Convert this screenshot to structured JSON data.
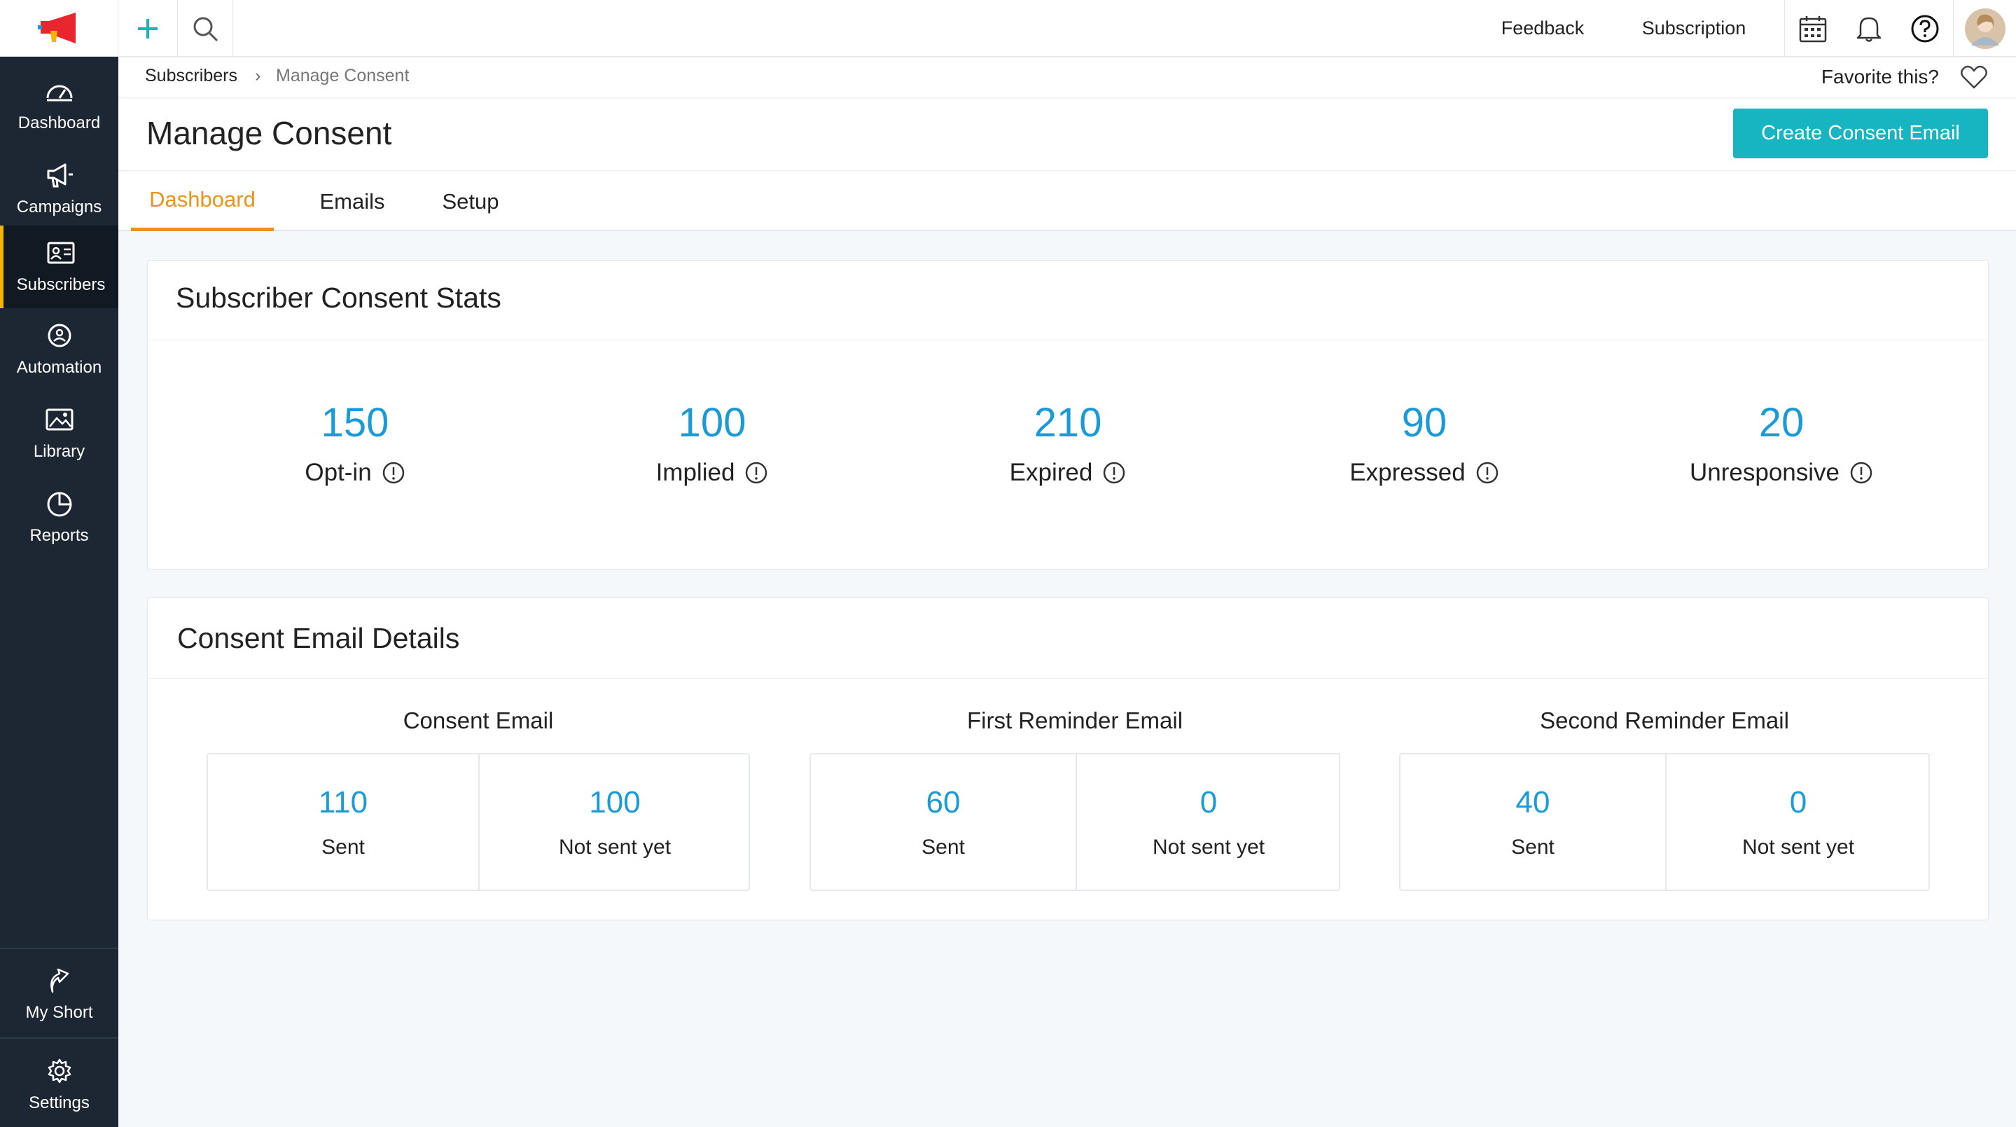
{
  "sidebar": {
    "items": [
      {
        "label": "Dashboard",
        "icon": "gauge-icon"
      },
      {
        "label": "Campaigns",
        "icon": "megaphone-icon"
      },
      {
        "label": "Subscribers",
        "icon": "contact-card-icon",
        "active": true
      },
      {
        "label": "Automation",
        "icon": "automation-icon"
      },
      {
        "label": "Library",
        "icon": "image-icon"
      },
      {
        "label": "Reports",
        "icon": "pie-chart-icon"
      }
    ],
    "bottom_items": [
      {
        "label": "My Short",
        "icon": "shortcut-icon"
      },
      {
        "label": "Settings",
        "icon": "gear-icon"
      }
    ]
  },
  "topbar": {
    "feedback": "Feedback",
    "subscription": "Subscription"
  },
  "breadcrumb": {
    "parent": "Subscribers",
    "separator": "›",
    "current": "Manage Consent",
    "favorite": "Favorite this?"
  },
  "header": {
    "title": "Manage Consent",
    "create_button": "Create Consent Email"
  },
  "tabs": [
    {
      "label": "Dashboard",
      "active": true
    },
    {
      "label": "Emails"
    },
    {
      "label": "Setup"
    }
  ],
  "stats_card": {
    "title": "Subscriber Consent Stats",
    "stats": [
      {
        "value": "150",
        "label": "Opt-in"
      },
      {
        "value": "100",
        "label": "Implied"
      },
      {
        "value": "210",
        "label": "Expired"
      },
      {
        "value": "90",
        "label": "Expressed"
      },
      {
        "value": "20",
        "label": "Unresponsive"
      }
    ]
  },
  "details_card": {
    "title": "Consent Email Details",
    "groups": [
      {
        "title": "Consent Email",
        "sent": "110",
        "sent_label": "Sent",
        "not_sent": "100",
        "not_sent_label": "Not sent yet"
      },
      {
        "title": "First Reminder Email",
        "sent": "60",
        "sent_label": "Sent",
        "not_sent": "0",
        "not_sent_label": "Not sent yet"
      },
      {
        "title": "Second Reminder Email",
        "sent": "40",
        "sent_label": "Sent",
        "not_sent": "0",
        "not_sent_label": "Not sent yet"
      }
    ]
  },
  "colors": {
    "accent": "#16b5c1",
    "tab_active": "#e8931a",
    "stat_number": "#1a9ad7",
    "sidebar_bg": "#1d2733"
  }
}
